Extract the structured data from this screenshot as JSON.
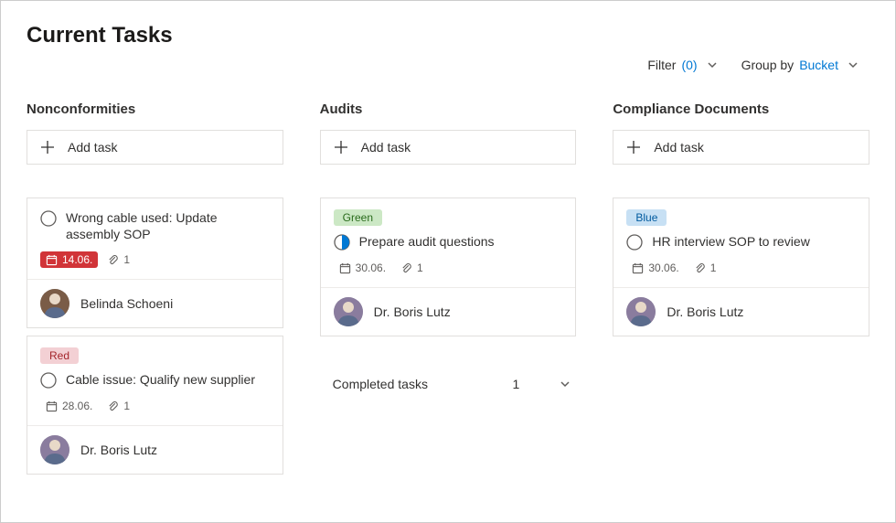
{
  "page": {
    "title": "Current Tasks"
  },
  "toolbar": {
    "filter_label": "Filter",
    "filter_count": "(0)",
    "group_label": "Group by",
    "group_value": "Bucket"
  },
  "add_task_label": "Add task",
  "columns": [
    {
      "title": "Nonconformities",
      "cards": [
        {
          "tag": null,
          "tag_class": null,
          "title": "Wrong cable used: Update assembly SOP",
          "progress": "empty",
          "date": "14.06.",
          "overdue": true,
          "attachments": "1",
          "assignee": {
            "name": "Belinda Schoeni",
            "avatar_bg": "#7a5c47",
            "avatar_variant": "f1"
          }
        },
        {
          "tag": "Red",
          "tag_class": "tag-red",
          "title": "Cable issue: Qualify new supplier",
          "progress": "empty",
          "date": "28.06.",
          "overdue": false,
          "attachments": "1",
          "assignee": {
            "name": "Dr. Boris Lutz",
            "avatar_bg": "#8a7c9e",
            "avatar_variant": "m1"
          }
        }
      ]
    },
    {
      "title": "Audits",
      "cards": [
        {
          "tag": "Green",
          "tag_class": "tag-green",
          "title": "Prepare audit questions",
          "progress": "half",
          "date": "30.06.",
          "overdue": false,
          "attachments": "1",
          "assignee": {
            "name": "Dr. Boris Lutz",
            "avatar_bg": "#8a7c9e",
            "avatar_variant": "m1"
          }
        }
      ],
      "completed": {
        "label": "Completed tasks",
        "count": "1"
      }
    },
    {
      "title": "Compliance Documents",
      "cards": [
        {
          "tag": "Blue",
          "tag_class": "tag-blue",
          "title": "HR interview SOP to review",
          "progress": "empty",
          "date": "30.06.",
          "overdue": false,
          "attachments": "1",
          "assignee": {
            "name": "Dr. Boris Lutz",
            "avatar_bg": "#8a7c9e",
            "avatar_variant": "m1"
          }
        }
      ]
    }
  ]
}
